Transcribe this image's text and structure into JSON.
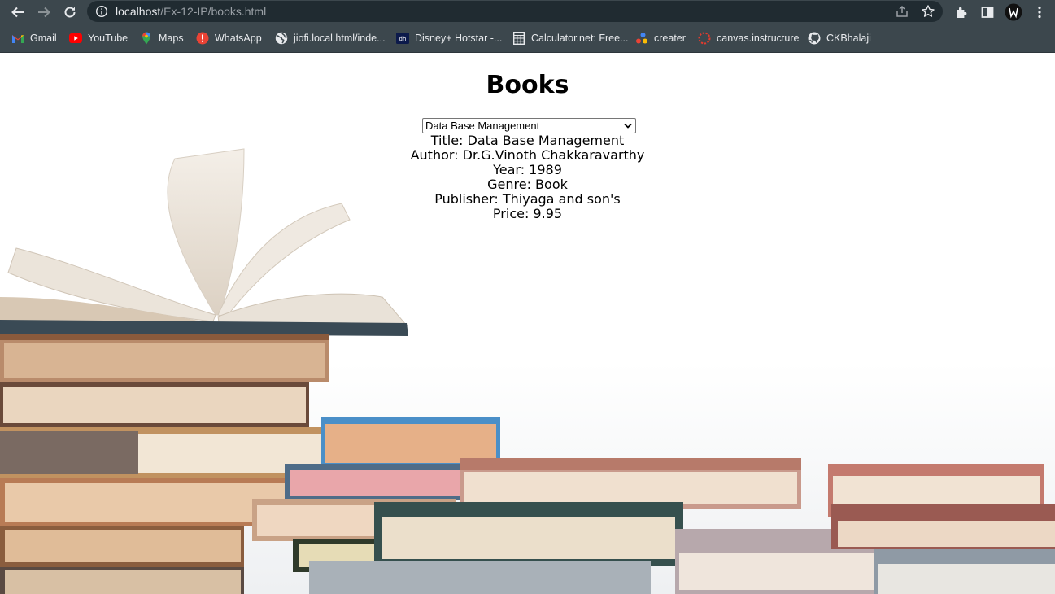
{
  "browser": {
    "url_host": "localhost",
    "url_path": "/Ex-12-IP/books.html",
    "bookmarks": [
      {
        "label": "Gmail",
        "icon": "gmail-icon"
      },
      {
        "label": "YouTube",
        "icon": "youtube-icon"
      },
      {
        "label": "Maps",
        "icon": "maps-icon"
      },
      {
        "label": "WhatsApp",
        "icon": "whatsapp-icon"
      },
      {
        "label": "jiofi.local.html/inde...",
        "icon": "globe-icon"
      },
      {
        "label": "Disney+ Hotstar -...",
        "icon": "hotstar-icon"
      },
      {
        "label": "Calculator.net: Free...",
        "icon": "calculator-icon"
      },
      {
        "label": "creater",
        "icon": "creater-icon"
      },
      {
        "label": "canvas.instructure",
        "icon": "canvas-icon"
      },
      {
        "label": "CKBhalaji",
        "icon": "github-icon"
      }
    ]
  },
  "page": {
    "title": "Books",
    "select": {
      "selected": "Data Base Management"
    },
    "details": {
      "title": "Title: Data Base Management",
      "author": "Author: Dr.G.Vinoth Chakkaravarthy",
      "year": "Year: 1989",
      "genre": "Genre: Book",
      "publisher": "Publisher: Thiyaga and son's",
      "price": "Price: 9.95"
    }
  },
  "colors": {
    "chrome": "#3c474d",
    "omnibox": "#202b31",
    "page_background": "#ffffff"
  }
}
